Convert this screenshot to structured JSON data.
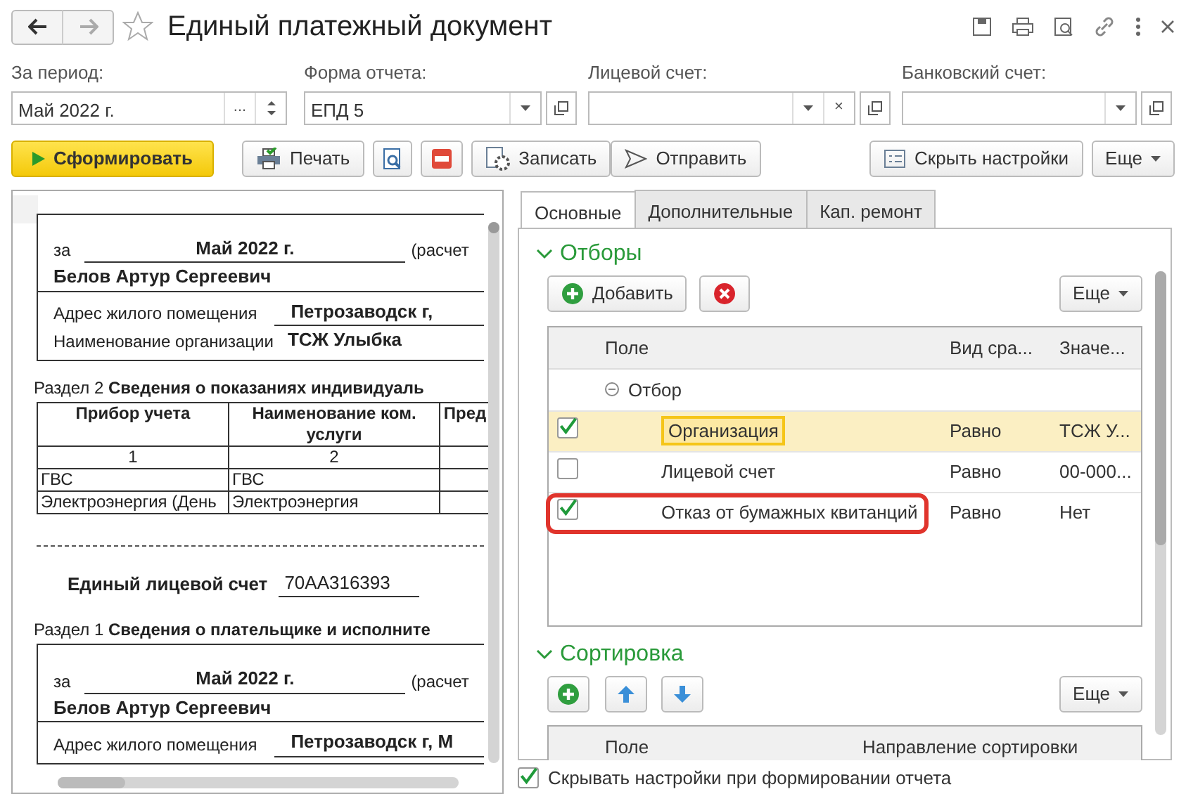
{
  "window": {
    "title": "Единый платежный документ",
    "favorite": false
  },
  "filters": [
    {
      "kind": "period",
      "label": "За период:",
      "value": "Май 2022 г.",
      "choose_button": "..."
    },
    {
      "kind": "select",
      "label": "Форма отчета:",
      "value": "ЕПД 5"
    },
    {
      "kind": "select_clear",
      "label": "Лицевой счет:",
      "clear_button": "×"
    },
    {
      "kind": "select",
      "label": "Банковский счет:"
    }
  ],
  "toolbar": {
    "generate": "Сформировать",
    "print": "Печать",
    "save": "Записать",
    "send": "Отправить",
    "hide_settings": "Скрыть настройки",
    "more": "Еще"
  },
  "report": {
    "header1": {
      "for": "за",
      "period": "Май 2022 г.",
      "calc": "(расчет",
      "payer": "Белов Артур Сергеевич",
      "address_label": "Адрес жилого помещения",
      "address": "Петрозаводск г,",
      "org_label": "Наименование организации",
      "org": "ТСЖ Улыбка"
    },
    "section2": {
      "number": "Раздел 2",
      "title": "Сведения о показаниях индивидуаль",
      "columns": [
        "Прибор учета",
        "Наименование ком. услуги",
        "Пред"
      ],
      "column_numbers": [
        "1",
        "2"
      ],
      "rows": [
        [
          "ГВС",
          "ГВС"
        ],
        [
          "Электроэнергия (День",
          "Электроэнергия"
        ]
      ]
    },
    "account_label": "Единый лицевой счет",
    "account": "70АА316393",
    "section1": {
      "number": "Раздел 1",
      "title": "Сведения о плательщике и исполните"
    },
    "header2": {
      "for": "за",
      "period": "Май 2022 г.",
      "calc": "(расчет",
      "payer": "Белов Артур Сергеевич",
      "address_label": "Адрес жилого помещения",
      "address": "Петрозаводск г, М"
    }
  },
  "tabs": [
    {
      "label": "Основные",
      "selected": true
    },
    {
      "label": "Дополнительные",
      "selected": false
    },
    {
      "label": "Кап. ремонт",
      "selected": false
    }
  ],
  "selection": {
    "title": "Отборы",
    "expanded": true,
    "add": "Добавить",
    "more": "Еще",
    "columns": [
      "Поле",
      "Вид сра...",
      "Значе..."
    ],
    "group": {
      "label": "Отбор",
      "expanded": true
    },
    "rows": [
      {
        "field": "Организация",
        "comparison": "Равно",
        "value": "ТСЖ У...",
        "checked": true,
        "selected": true,
        "highlighted": false
      },
      {
        "field": "Лицевой счет",
        "comparison": "Равно",
        "value": "00-000...",
        "checked": false,
        "selected": false,
        "highlighted": false
      },
      {
        "field": "Отказ от бумажных квитанций",
        "comparison": "Равно",
        "value": "Нет",
        "checked": true,
        "selected": false,
        "highlighted": true
      }
    ]
  },
  "sorting": {
    "title": "Сортировка",
    "expanded": true,
    "more": "Еще",
    "columns": [
      "Поле",
      "Направление сортировки"
    ]
  },
  "hide_on_generate": {
    "label": "Скрывать настройки при формировании отчета",
    "checked": true
  }
}
